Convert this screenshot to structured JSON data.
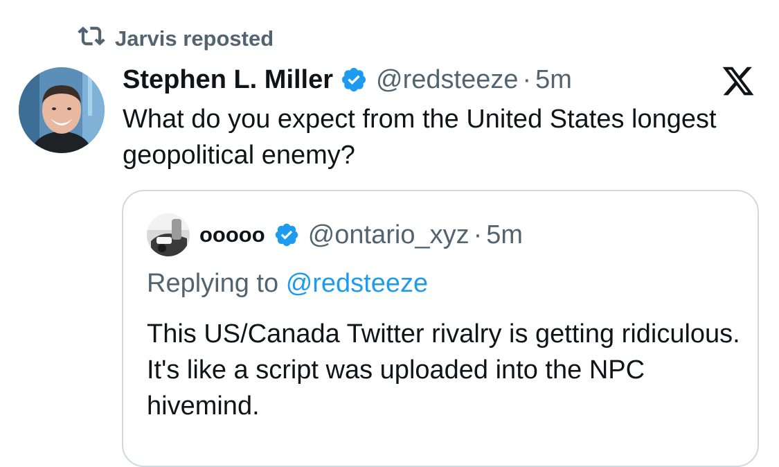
{
  "repost": {
    "icon": "repost-icon",
    "text": "Jarvis reposted"
  },
  "tweet": {
    "author_name": "Stephen L. Miller",
    "verified_icon": "verified-badge-icon",
    "handle": "@redsteeze",
    "separator": "·",
    "time": "5m",
    "text": "What do you expect from the United States longest geopolitical enemy?",
    "brand_icon": "x-logo-icon"
  },
  "quote": {
    "author_name": "ooooo",
    "verified_icon": "verified-badge-icon",
    "handle": "@ontario_xyz",
    "separator": "·",
    "time": "5m",
    "replying_prefix": "Replying to",
    "replying_mention": "@redsteeze",
    "text": "This US/Canada Twitter rivalry is getting ridiculous. It's like a script was uploaded into the NPC hivemind."
  },
  "colors": {
    "text_primary": "#0f1419",
    "text_secondary": "#536471",
    "accent_blue": "#1d9bf0",
    "border": "#cfd9de"
  }
}
